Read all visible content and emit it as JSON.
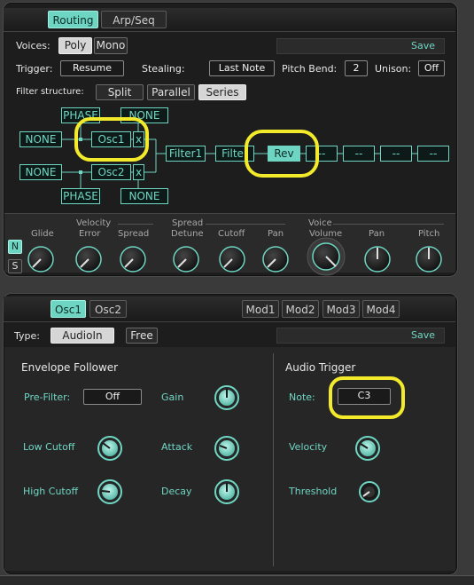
{
  "colors": {
    "accent": "#6ed5c3",
    "highlight": "#f2ea2b"
  },
  "top": {
    "tabs": [
      {
        "label": "Routing"
      },
      {
        "label": "Arp/Seq"
      }
    ],
    "voices_label": "Voices:",
    "poly": "Poly",
    "mono": "Mono",
    "save": "Save",
    "trigger_label": "Trigger:",
    "trigger_value": "Resume",
    "stealing_label": "Stealing:",
    "stealing_value": "Last Note",
    "pitch_bend_label": "Pitch Bend:",
    "pitch_bend_value": "2",
    "unison_label": "Unison:",
    "unison_value": "Off",
    "filter_structure_label": "Filter structure:",
    "filter_modes": [
      "Split",
      "Parallel",
      "Series"
    ],
    "routing": {
      "phase_top": "PHASE",
      "none_top": "NONE",
      "none_left1": "NONE",
      "osc1": "Osc1",
      "x1": "x",
      "none_left2": "NONE",
      "osc2": "Osc2",
      "x2": "x",
      "phase_bottom": "PHASE",
      "none_bottom": "NONE",
      "filter1": "Filter1",
      "filter2": "Filter",
      "rev": "Rev",
      "slots": [
        "--",
        "--",
        "--",
        "--"
      ]
    },
    "knob_groups": {
      "velocity": "Velocity",
      "spread": "Spread",
      "voice": "Voice"
    },
    "knob_labels": [
      "Glide",
      "Error",
      "Spread",
      "Detune",
      "Cutoff",
      "Pan",
      "Volume",
      "Pan",
      "Pitch"
    ],
    "n_button": "N",
    "s_button": "S"
  },
  "bottom": {
    "tabs": [
      {
        "label": "Osc1"
      },
      {
        "label": "Osc2"
      }
    ],
    "mod_tabs": [
      "Mod1",
      "Mod2",
      "Mod3",
      "Mod4"
    ],
    "type_label": "Type:",
    "type_options": [
      "AudioIn",
      "Free"
    ],
    "save": "Save",
    "env_title": "Envelope Follower",
    "audio_title": "Audio Trigger",
    "prefilter_label": "Pre-Filter:",
    "prefilter_value": "Off",
    "gain_label": "Gain",
    "low_cutoff_label": "Low Cutoff",
    "attack_label": "Attack",
    "high_cutoff_label": "High Cutoff",
    "decay_label": "Decay",
    "note_label": "Note:",
    "note_value": "C3",
    "velocity_label": "Velocity",
    "threshold_label": "Threshold"
  }
}
